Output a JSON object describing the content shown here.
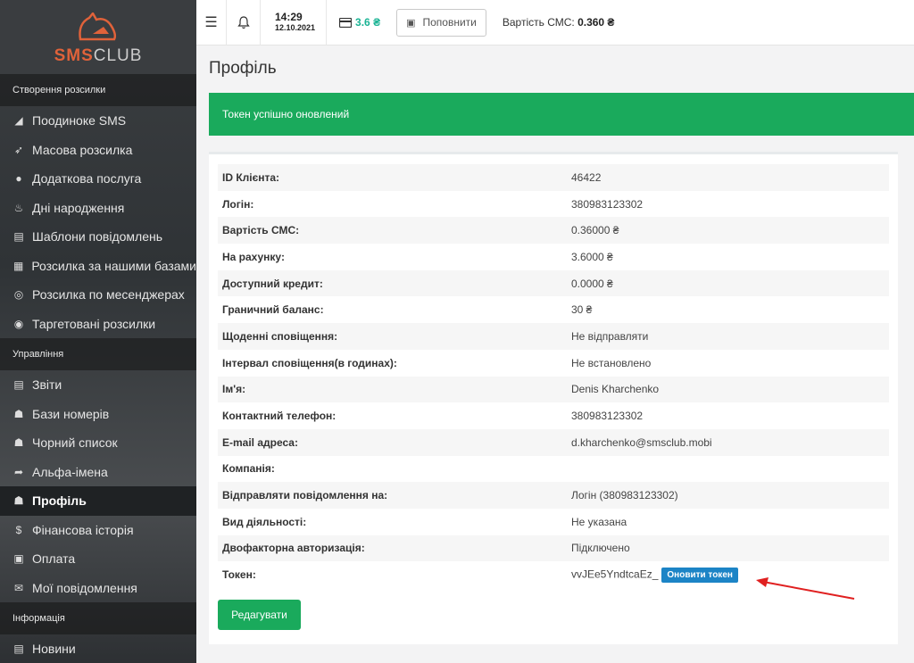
{
  "brand": {
    "name_a": "SMS",
    "name_b": "CLUB"
  },
  "sidebar": {
    "sections": [
      {
        "title": "Створення розсилки",
        "items": [
          {
            "label": "Поодиноке SMS",
            "icon": "send-icon",
            "glyph": "◢"
          },
          {
            "label": "Масова розсилка",
            "icon": "rocket-icon",
            "glyph": "➶"
          },
          {
            "label": "Додаткова послуга",
            "icon": "apple-icon",
            "glyph": "●"
          },
          {
            "label": "Дні народження",
            "icon": "cake-icon",
            "glyph": "♨"
          },
          {
            "label": "Шаблони повідомлень",
            "icon": "file-icon",
            "glyph": "▤"
          },
          {
            "label": "Розсилка за нашими базами",
            "icon": "table-icon",
            "glyph": "▦"
          },
          {
            "label": "Розсилка по месенджерах",
            "icon": "whatsapp-icon",
            "glyph": "◎"
          },
          {
            "label": "Таргетовані розсилки",
            "icon": "target-icon",
            "glyph": "◉"
          }
        ]
      },
      {
        "title": "Управління",
        "items": [
          {
            "label": "Звіти",
            "icon": "report-icon",
            "glyph": "▤"
          },
          {
            "label": "Бази номерів",
            "icon": "users-icon",
            "glyph": "☗"
          },
          {
            "label": "Чорний список",
            "icon": "user-block-icon",
            "glyph": "☗"
          },
          {
            "label": "Альфа-імена",
            "icon": "share-icon",
            "glyph": "➦"
          },
          {
            "label": "Профіль",
            "icon": "user-icon",
            "glyph": "☗",
            "active": true
          },
          {
            "label": "Фінансова історія",
            "icon": "dollar-icon",
            "glyph": "$"
          },
          {
            "label": "Оплата",
            "icon": "money-icon",
            "glyph": "▣"
          },
          {
            "label": "Мої повідомлення",
            "icon": "envelope-icon",
            "glyph": "✉"
          }
        ]
      },
      {
        "title": "Інформація",
        "items": [
          {
            "label": "Новини",
            "icon": "newspaper-icon",
            "glyph": "▤"
          }
        ]
      }
    ]
  },
  "topbar": {
    "time": "14:29",
    "date": "12.10.2021",
    "balance": "3.6 ₴",
    "refill_label": "Поповнити",
    "cost_label": "Вартість СМС:",
    "cost_value": "0.360 ₴"
  },
  "page": {
    "title": "Профіль",
    "alert": "Токен успішно оновлений",
    "edit_button": "Редагувати",
    "refresh_token_button": "Оновити токен"
  },
  "profile_rows": [
    {
      "key": "ID Клієнта:",
      "value": "46422"
    },
    {
      "key": "Логін:",
      "value": "380983123302"
    },
    {
      "key": "Вартість СМС:",
      "value": "0.36000 ₴"
    },
    {
      "key": "На рахунку:",
      "value": "3.6000 ₴"
    },
    {
      "key": "Доступний кредит:",
      "value": "0.0000 ₴"
    },
    {
      "key": "Граничний баланс:",
      "value": "30 ₴"
    },
    {
      "key": "Щоденні сповіщення:",
      "value": "Не відправляти"
    },
    {
      "key": "Інтервал сповіщення(в годинах):",
      "value": "Не встановлено"
    },
    {
      "key": "Ім'я:",
      "value": "Denis Kharchenko"
    },
    {
      "key": "Контактний телефон:",
      "value": "380983123302"
    },
    {
      "key": "E-mail адреса:",
      "value": "d.kharchenko@smsclub.mobi"
    },
    {
      "key": "Компанія:",
      "value": ""
    },
    {
      "key": "Відправляти повідомлення на:",
      "value": "Логін (380983123302)"
    },
    {
      "key": "Вид діяльності:",
      "value": "Не указана"
    },
    {
      "key": "Двофакторна авторизація:",
      "value": "Підключено"
    },
    {
      "key": "Токен:",
      "value": "vvJEe5YndtcaEz_",
      "token": true
    }
  ],
  "colors": {
    "accent_green": "#1aaa5c",
    "token_button": "#1c84c6",
    "arrow": "#e02020",
    "sidebar": "#2f3336"
  }
}
